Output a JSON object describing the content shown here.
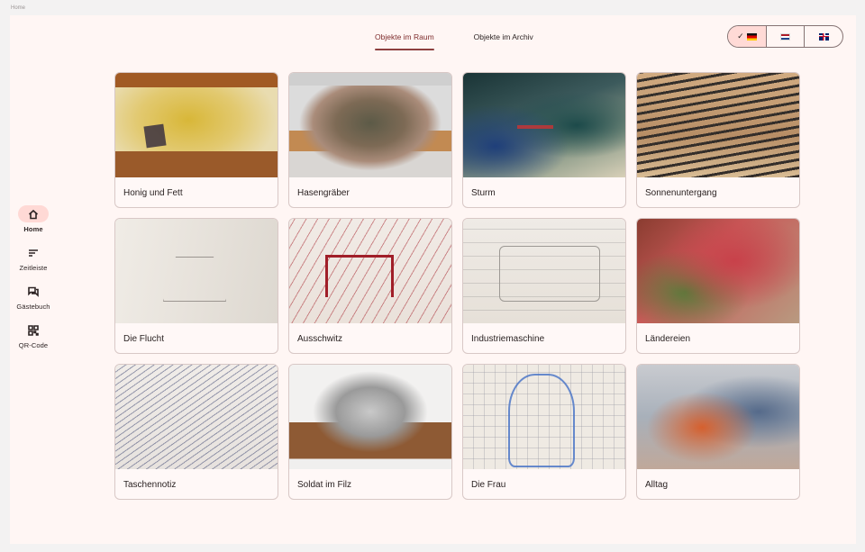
{
  "breadcrumb": "Home",
  "nav": {
    "items": [
      {
        "label": "Home",
        "icon": "home-icon",
        "active": true
      },
      {
        "label": "Zeitleiste",
        "icon": "timeline-icon",
        "active": false
      },
      {
        "label": "Gästebuch",
        "icon": "guestbook-icon",
        "active": false
      },
      {
        "label": "QR-Code",
        "icon": "qr-code-icon",
        "active": false
      }
    ]
  },
  "tabs": [
    {
      "label": "Objekte im Raum",
      "active": true
    },
    {
      "label": "Objekte im Archiv",
      "active": false
    }
  ],
  "languages": [
    {
      "code": "de",
      "icon": "flag-germany-icon",
      "selected": true
    },
    {
      "code": "nl",
      "icon": "flag-netherlands-icon",
      "selected": false
    },
    {
      "code": "en",
      "icon": "flag-uk-icon",
      "selected": false
    }
  ],
  "cards": [
    {
      "title": "Honig und Fett"
    },
    {
      "title": "Hasengräber"
    },
    {
      "title": "Sturm"
    },
    {
      "title": "Sonnenuntergang"
    },
    {
      "title": "Die Flucht"
    },
    {
      "title": "Ausschwitz"
    },
    {
      "title": "Industriemaschine"
    },
    {
      "title": "Ländereien"
    },
    {
      "title": "Taschennotiz"
    },
    {
      "title": "Soldat im Filz"
    },
    {
      "title": "Die Frau"
    },
    {
      "title": "Alltag"
    }
  ],
  "colors": {
    "accent": "#8d3f3f",
    "active_pill": "#ffdad6",
    "background": "#fff6f4"
  }
}
